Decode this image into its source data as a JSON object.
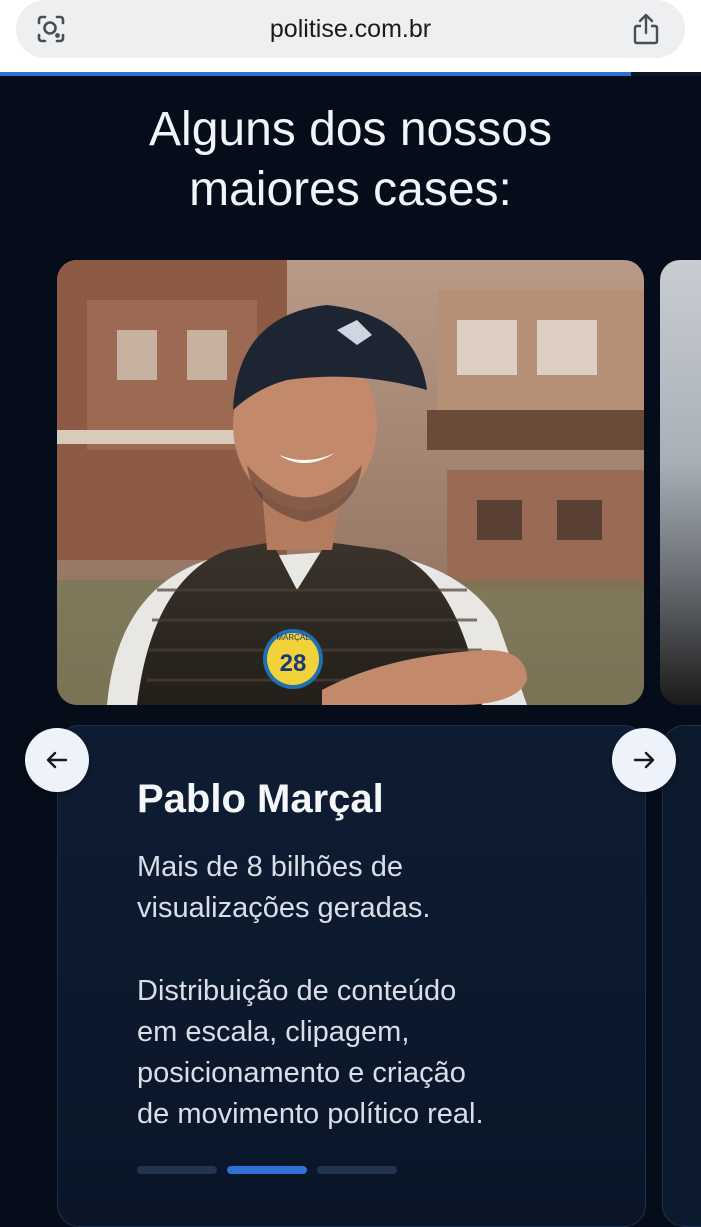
{
  "browser": {
    "url": "politise.com.br",
    "lens_icon": "search-lens-icon",
    "share_icon": "share-icon",
    "load_progress": 0.9
  },
  "section": {
    "title_line1": "Alguns dos nossos",
    "title_line2": "maiores cases:"
  },
  "carousel": {
    "prev_icon": "arrow-left-icon",
    "next_icon": "arrow-right-icon",
    "active_index": 1,
    "total_dots": 3,
    "current_case": {
      "name": "Pablo Marçal",
      "line1": "Mais de 8 bilhões de",
      "line2": "visualizações geradas.",
      "line3": "Distribuição de conteúdo",
      "line4": "em escala, clipagem,",
      "line5": "posicionamento e criação",
      "line6": "de movimento político real.",
      "photo_badge_name": "MARÇAL",
      "photo_badge_number": "28"
    }
  },
  "colors": {
    "page_bg": "#050d1a",
    "card_bg": "#0e1d33",
    "accent": "#2f6fd6",
    "title_text": "#f2f4f8"
  }
}
